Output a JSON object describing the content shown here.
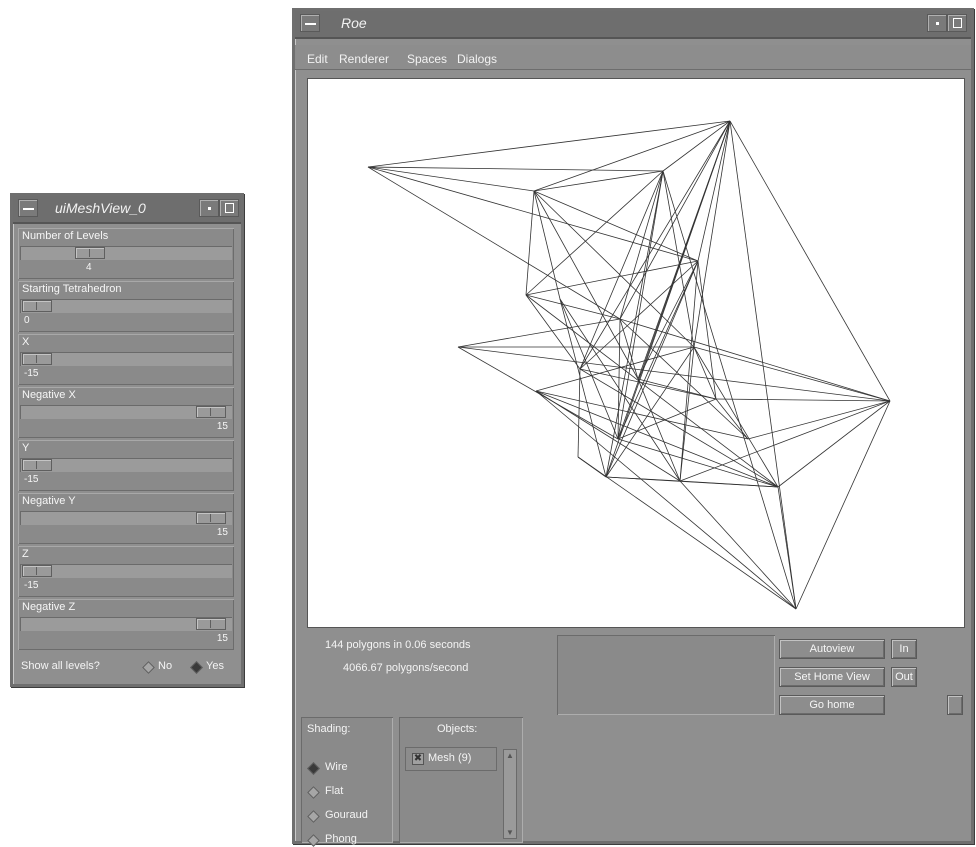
{
  "mesh_view": {
    "title": "uiMeshView_0",
    "params": [
      {
        "label": "Number of Levels",
        "value": "4"
      },
      {
        "label": "Starting Tetrahedron",
        "value": "0"
      },
      {
        "label": "X",
        "value": "-15"
      },
      {
        "label": "Negative X",
        "value": "15"
      },
      {
        "label": "Y",
        "value": "-15"
      },
      {
        "label": "Negative Y",
        "value": "15"
      },
      {
        "label": "Z",
        "value": "-15"
      },
      {
        "label": "Negative Z",
        "value": "15"
      }
    ],
    "show_all_label": "Show all levels?",
    "no_label": "No",
    "yes_label": "Yes",
    "show_all_selected": "Yes"
  },
  "roe": {
    "title": "Roe",
    "menu": [
      "Edit",
      "Renderer",
      "Spaces",
      "Dialogs"
    ],
    "stats_line1": "144 polygons in 0.06 seconds",
    "stats_line2": "4066.67 polygons/second",
    "buttons": {
      "autoview": "Autoview",
      "zoom_in": "In",
      "set_home": "Set Home View",
      "zoom_out": "Out",
      "go_home": "Go home"
    },
    "shading": {
      "title": "Shading:",
      "options": [
        "Wire",
        "Flat",
        "Gouraud",
        "Phong"
      ],
      "selected": "Wire"
    },
    "objects": {
      "title": "Objects:",
      "items": [
        {
          "label": "Mesh (9)",
          "checked": true
        }
      ]
    }
  }
}
